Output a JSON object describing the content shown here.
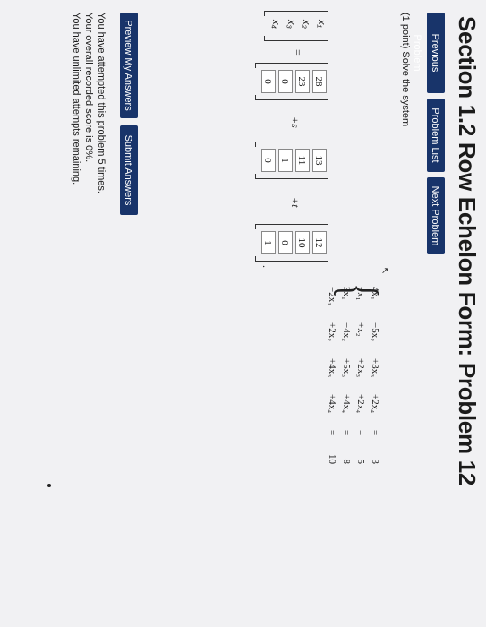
{
  "page_title": "Section 1.2 Row Echelon Form: Problem 12",
  "nav": {
    "previous": "Previous Problem",
    "list": "Problem List",
    "next": "Next Problem"
  },
  "problem": {
    "prompt": "(1 point) Solve the system",
    "equations": [
      [
        "4x₁",
        "−5x₂",
        "+3x₃",
        "+2x₄",
        "=",
        "3"
      ],
      [
        "−x₁",
        "+x₂",
        "+2x₃",
        "+2x₄",
        "=",
        "5"
      ],
      [
        "3x₁",
        "−4x₂",
        "+5x₃",
        "+4x₄",
        "=",
        "8"
      ],
      [
        "−2x₁",
        "+2x₂",
        "+4x₃",
        "+4x₄",
        "=",
        "10"
      ]
    ],
    "variables": [
      "x₁",
      "x₂",
      "x₃",
      "x₄"
    ],
    "equals_sign": "=",
    "plus_s": "+s",
    "plus_t": "+t",
    "particular": [
      "28",
      "23",
      "0",
      "0"
    ],
    "vector_s": [
      "13",
      "11",
      "1",
      "0"
    ],
    "vector_t": [
      "12",
      "10",
      "0",
      "1"
    ]
  },
  "actions": {
    "preview": "Preview My Answers",
    "submit": "Submit Answers"
  },
  "status": {
    "attempts": "You have attempted this problem 5 times.",
    "score": "Your overall recorded score is 0%.",
    "remaining": "You have unlimited attempts remaining."
  }
}
